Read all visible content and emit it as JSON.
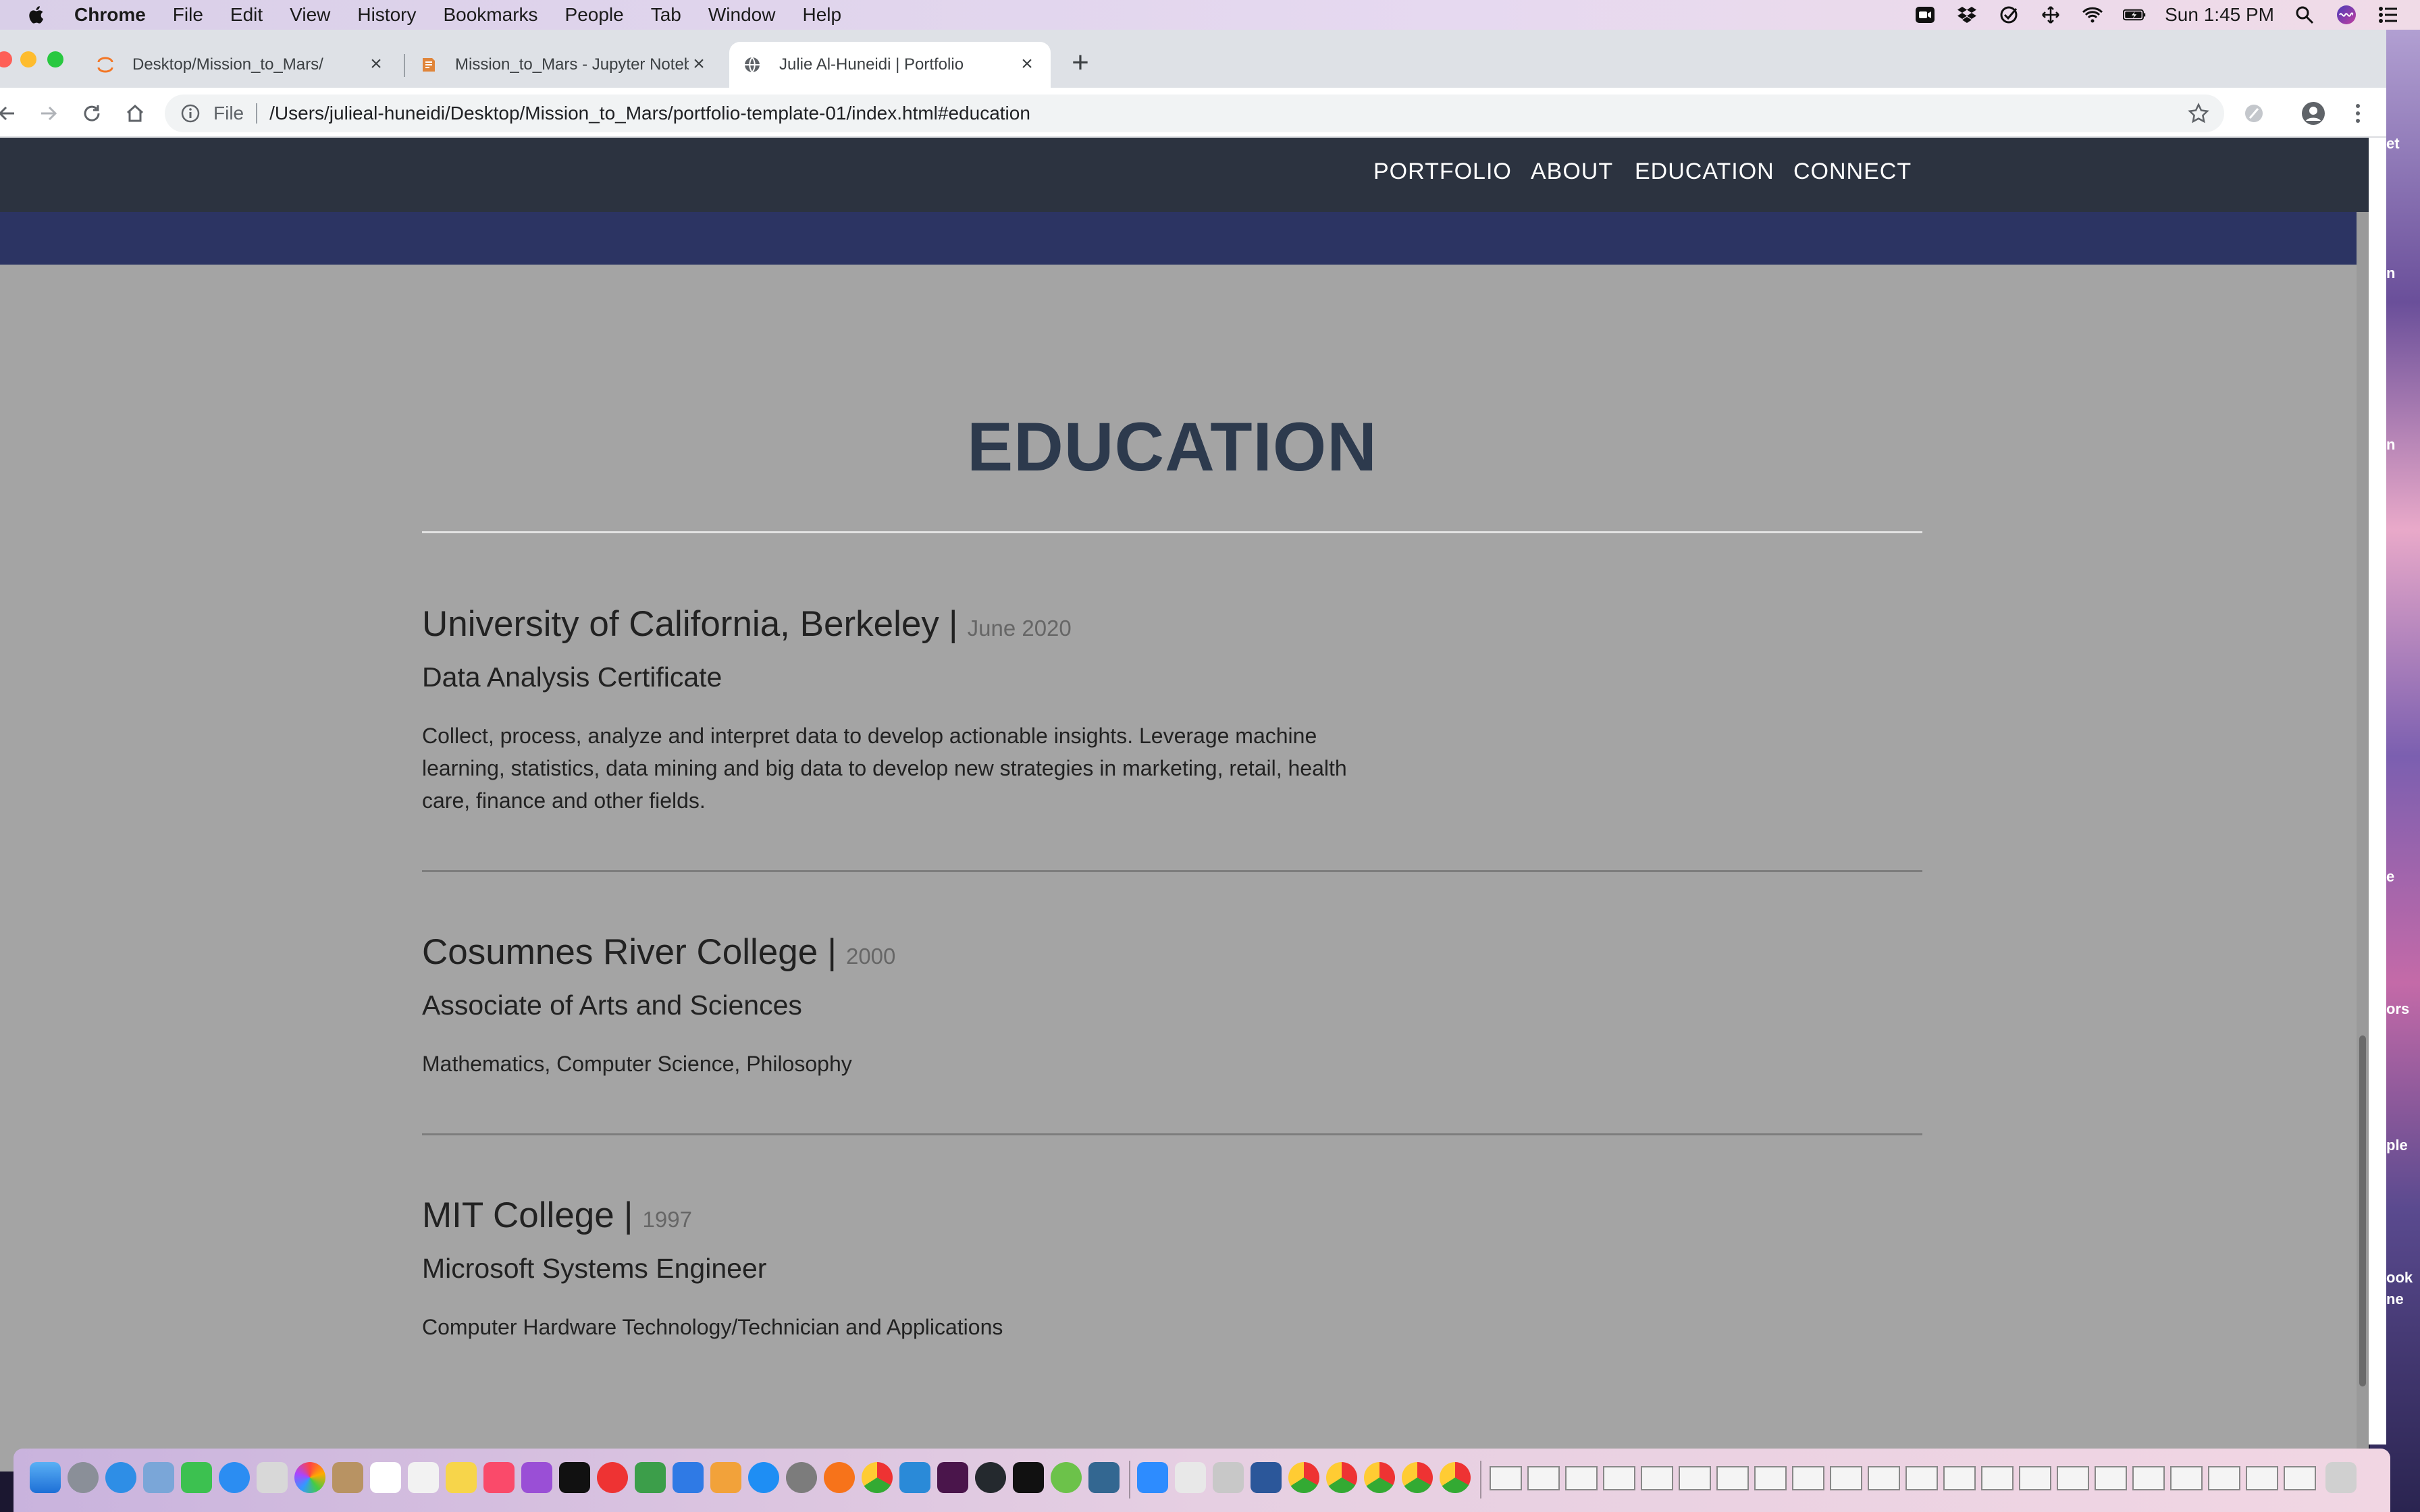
{
  "menubar": {
    "app_name": "Chrome",
    "items": [
      "File",
      "Edit",
      "View",
      "History",
      "Bookmarks",
      "People",
      "Tab",
      "Window",
      "Help"
    ],
    "clock": "Sun 1:45 PM"
  },
  "tabs": [
    {
      "label": "Desktop/Mission_to_Mars/",
      "icon": "jupyter-icon",
      "active": false
    },
    {
      "label": "Mission_to_Mars - Jupyter Noteb",
      "icon": "notebook-icon",
      "active": false
    },
    {
      "label": "Julie Al-Huneidi | Portfolio",
      "icon": "globe-icon",
      "active": true
    }
  ],
  "address_bar": {
    "scheme": "File",
    "url": "/Users/julieal-huneidi/Desktop/Mission_to_Mars/portfolio-template-01/index.html#education"
  },
  "site_nav": [
    "PORTFOLIO",
    "ABOUT",
    "EDUCATION",
    "CONNECT"
  ],
  "section_title": "EDUCATION",
  "education": [
    {
      "school": "University of California, Berkeley",
      "pipe": "|",
      "date": "June 2020",
      "degree": "Data Analysis Certificate",
      "description": "Collect, process, analyze and interpret data to develop actionable insights. Leverage machine learning, statistics, data mining and big data to develop new strategies in marketing, retail, health care, finance and other fields."
    },
    {
      "school": "Cosumnes River College",
      "pipe": "|",
      "date": "2000",
      "degree": "Associate of Arts and Sciences",
      "description": "Mathematics, Computer Science, Philosophy"
    },
    {
      "school": "MIT College",
      "pipe": "|",
      "date": "1997",
      "degree": "Microsoft Systems Engineer",
      "description": "Computer Hardware Technology/Technician and Applications"
    }
  ],
  "wallpaper_fragments": [
    "et",
    "n",
    "n",
    "e",
    "ors",
    "ple",
    "ook",
    "ne"
  ],
  "colors": {
    "nav_bg": "#2c3340",
    "band_stripe": "#2c3463",
    "page_bg": "#a4a4a4",
    "title_color": "#2d3a4d"
  }
}
